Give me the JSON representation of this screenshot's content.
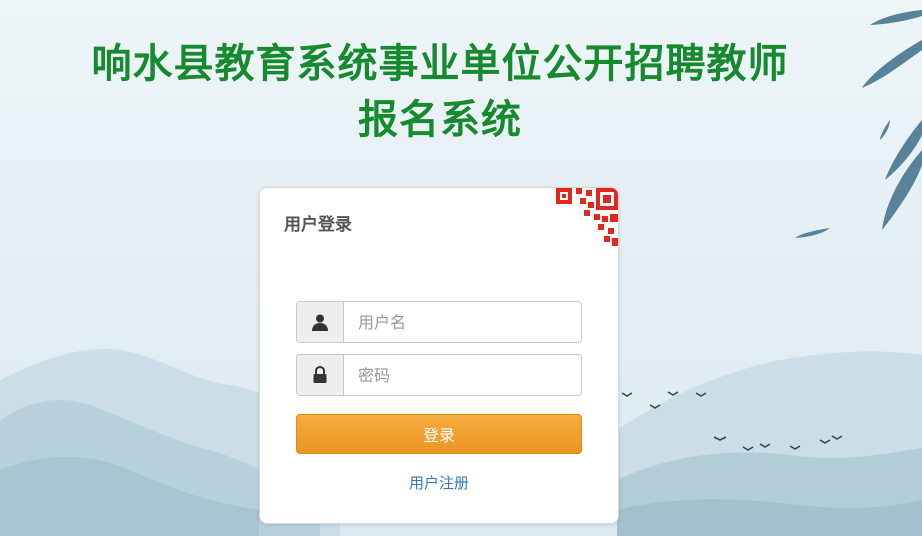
{
  "page": {
    "title_line1": "响水县教育系统事业单位公开招聘教师",
    "title_line2": "报名系统"
  },
  "login": {
    "heading": "用户登录",
    "username_placeholder": "用户名",
    "password_placeholder": "密码",
    "submit_label": "登录",
    "register_link": "用户注册"
  },
  "icons": {
    "username": "user-icon",
    "password": "lock-icon",
    "qr": "qr-code-corner-icon"
  },
  "colors": {
    "title": "#168a2e",
    "button": "#ec9420",
    "link": "#337ab7",
    "qr": "#e0281e"
  }
}
